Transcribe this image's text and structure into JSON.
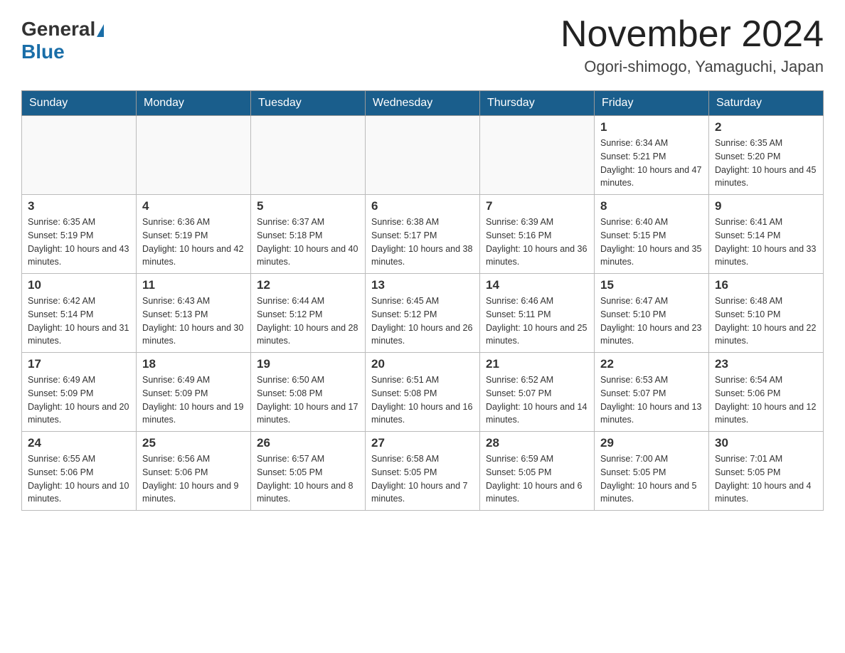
{
  "header": {
    "logo_general": "General",
    "logo_blue": "Blue",
    "month_title": "November 2024",
    "location": "Ogori-shimogo, Yamaguchi, Japan"
  },
  "days_of_week": [
    "Sunday",
    "Monday",
    "Tuesday",
    "Wednesday",
    "Thursday",
    "Friday",
    "Saturday"
  ],
  "weeks": [
    [
      {
        "day": "",
        "sunrise": "",
        "sunset": "",
        "daylight": ""
      },
      {
        "day": "",
        "sunrise": "",
        "sunset": "",
        "daylight": ""
      },
      {
        "day": "",
        "sunrise": "",
        "sunset": "",
        "daylight": ""
      },
      {
        "day": "",
        "sunrise": "",
        "sunset": "",
        "daylight": ""
      },
      {
        "day": "",
        "sunrise": "",
        "sunset": "",
        "daylight": ""
      },
      {
        "day": "1",
        "sunrise": "Sunrise: 6:34 AM",
        "sunset": "Sunset: 5:21 PM",
        "daylight": "Daylight: 10 hours and 47 minutes."
      },
      {
        "day": "2",
        "sunrise": "Sunrise: 6:35 AM",
        "sunset": "Sunset: 5:20 PM",
        "daylight": "Daylight: 10 hours and 45 minutes."
      }
    ],
    [
      {
        "day": "3",
        "sunrise": "Sunrise: 6:35 AM",
        "sunset": "Sunset: 5:19 PM",
        "daylight": "Daylight: 10 hours and 43 minutes."
      },
      {
        "day": "4",
        "sunrise": "Sunrise: 6:36 AM",
        "sunset": "Sunset: 5:19 PM",
        "daylight": "Daylight: 10 hours and 42 minutes."
      },
      {
        "day": "5",
        "sunrise": "Sunrise: 6:37 AM",
        "sunset": "Sunset: 5:18 PM",
        "daylight": "Daylight: 10 hours and 40 minutes."
      },
      {
        "day": "6",
        "sunrise": "Sunrise: 6:38 AM",
        "sunset": "Sunset: 5:17 PM",
        "daylight": "Daylight: 10 hours and 38 minutes."
      },
      {
        "day": "7",
        "sunrise": "Sunrise: 6:39 AM",
        "sunset": "Sunset: 5:16 PM",
        "daylight": "Daylight: 10 hours and 36 minutes."
      },
      {
        "day": "8",
        "sunrise": "Sunrise: 6:40 AM",
        "sunset": "Sunset: 5:15 PM",
        "daylight": "Daylight: 10 hours and 35 minutes."
      },
      {
        "day": "9",
        "sunrise": "Sunrise: 6:41 AM",
        "sunset": "Sunset: 5:14 PM",
        "daylight": "Daylight: 10 hours and 33 minutes."
      }
    ],
    [
      {
        "day": "10",
        "sunrise": "Sunrise: 6:42 AM",
        "sunset": "Sunset: 5:14 PM",
        "daylight": "Daylight: 10 hours and 31 minutes."
      },
      {
        "day": "11",
        "sunrise": "Sunrise: 6:43 AM",
        "sunset": "Sunset: 5:13 PM",
        "daylight": "Daylight: 10 hours and 30 minutes."
      },
      {
        "day": "12",
        "sunrise": "Sunrise: 6:44 AM",
        "sunset": "Sunset: 5:12 PM",
        "daylight": "Daylight: 10 hours and 28 minutes."
      },
      {
        "day": "13",
        "sunrise": "Sunrise: 6:45 AM",
        "sunset": "Sunset: 5:12 PM",
        "daylight": "Daylight: 10 hours and 26 minutes."
      },
      {
        "day": "14",
        "sunrise": "Sunrise: 6:46 AM",
        "sunset": "Sunset: 5:11 PM",
        "daylight": "Daylight: 10 hours and 25 minutes."
      },
      {
        "day": "15",
        "sunrise": "Sunrise: 6:47 AM",
        "sunset": "Sunset: 5:10 PM",
        "daylight": "Daylight: 10 hours and 23 minutes."
      },
      {
        "day": "16",
        "sunrise": "Sunrise: 6:48 AM",
        "sunset": "Sunset: 5:10 PM",
        "daylight": "Daylight: 10 hours and 22 minutes."
      }
    ],
    [
      {
        "day": "17",
        "sunrise": "Sunrise: 6:49 AM",
        "sunset": "Sunset: 5:09 PM",
        "daylight": "Daylight: 10 hours and 20 minutes."
      },
      {
        "day": "18",
        "sunrise": "Sunrise: 6:49 AM",
        "sunset": "Sunset: 5:09 PM",
        "daylight": "Daylight: 10 hours and 19 minutes."
      },
      {
        "day": "19",
        "sunrise": "Sunrise: 6:50 AM",
        "sunset": "Sunset: 5:08 PM",
        "daylight": "Daylight: 10 hours and 17 minutes."
      },
      {
        "day": "20",
        "sunrise": "Sunrise: 6:51 AM",
        "sunset": "Sunset: 5:08 PM",
        "daylight": "Daylight: 10 hours and 16 minutes."
      },
      {
        "day": "21",
        "sunrise": "Sunrise: 6:52 AM",
        "sunset": "Sunset: 5:07 PM",
        "daylight": "Daylight: 10 hours and 14 minutes."
      },
      {
        "day": "22",
        "sunrise": "Sunrise: 6:53 AM",
        "sunset": "Sunset: 5:07 PM",
        "daylight": "Daylight: 10 hours and 13 minutes."
      },
      {
        "day": "23",
        "sunrise": "Sunrise: 6:54 AM",
        "sunset": "Sunset: 5:06 PM",
        "daylight": "Daylight: 10 hours and 12 minutes."
      }
    ],
    [
      {
        "day": "24",
        "sunrise": "Sunrise: 6:55 AM",
        "sunset": "Sunset: 5:06 PM",
        "daylight": "Daylight: 10 hours and 10 minutes."
      },
      {
        "day": "25",
        "sunrise": "Sunrise: 6:56 AM",
        "sunset": "Sunset: 5:06 PM",
        "daylight": "Daylight: 10 hours and 9 minutes."
      },
      {
        "day": "26",
        "sunrise": "Sunrise: 6:57 AM",
        "sunset": "Sunset: 5:05 PM",
        "daylight": "Daylight: 10 hours and 8 minutes."
      },
      {
        "day": "27",
        "sunrise": "Sunrise: 6:58 AM",
        "sunset": "Sunset: 5:05 PM",
        "daylight": "Daylight: 10 hours and 7 minutes."
      },
      {
        "day": "28",
        "sunrise": "Sunrise: 6:59 AM",
        "sunset": "Sunset: 5:05 PM",
        "daylight": "Daylight: 10 hours and 6 minutes."
      },
      {
        "day": "29",
        "sunrise": "Sunrise: 7:00 AM",
        "sunset": "Sunset: 5:05 PM",
        "daylight": "Daylight: 10 hours and 5 minutes."
      },
      {
        "day": "30",
        "sunrise": "Sunrise: 7:01 AM",
        "sunset": "Sunset: 5:05 PM",
        "daylight": "Daylight: 10 hours and 4 minutes."
      }
    ]
  ]
}
